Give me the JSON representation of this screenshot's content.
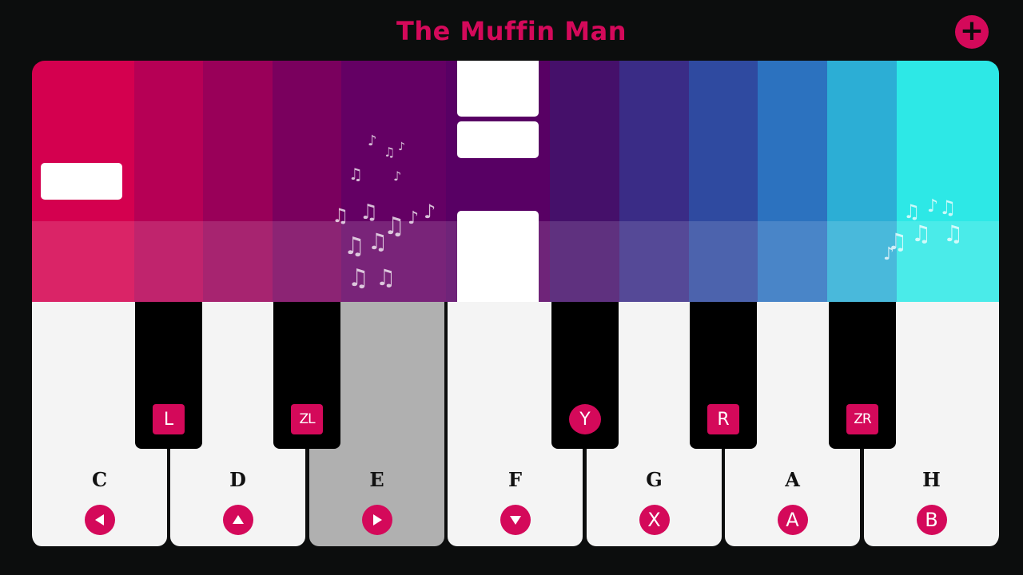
{
  "song_title": "The Muffin Man",
  "add_button": "+",
  "lane_colors": [
    "#d4004f",
    "#b60055",
    "#990059",
    "#7a005e",
    "#640064",
    "#580064",
    "#4e0067",
    "#3f0c6c",
    "#3a2c86",
    "#2f4aa0",
    "#2c72bf",
    "#2caed5",
    "#2de8e6"
  ],
  "white_keys": [
    {
      "label": "C",
      "button": "left-arrow",
      "active": false
    },
    {
      "label": "D",
      "button": "up-arrow",
      "active": false
    },
    {
      "label": "E",
      "button": "right-arrow",
      "active": true
    },
    {
      "label": "F",
      "button": "down-arrow",
      "active": false
    },
    {
      "label": "G",
      "button": "X",
      "active": false
    },
    {
      "label": "A",
      "button": "A",
      "active": false
    },
    {
      "label": "H",
      "button": "B",
      "active": false
    }
  ],
  "black_keys": [
    {
      "label": "L",
      "shape": "square"
    },
    {
      "label": "ZL",
      "shape": "square"
    },
    {
      "label": "Y",
      "shape": "round"
    },
    {
      "label": "R",
      "shape": "square"
    },
    {
      "label": "ZR",
      "shape": "square"
    }
  ],
  "accent_color": "#d4095a"
}
